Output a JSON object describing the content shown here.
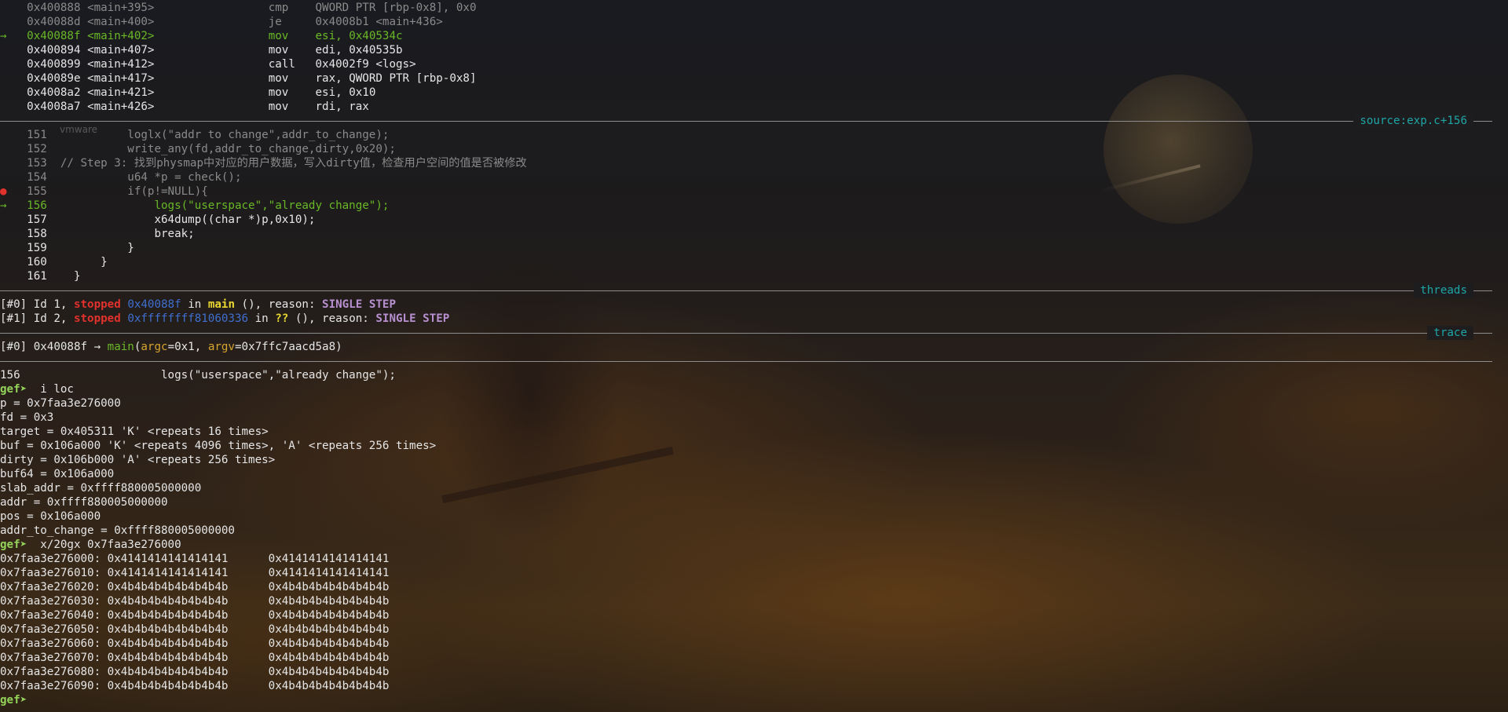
{
  "disasm": [
    {
      "addr": "0x400888",
      "sym": "<main+395>",
      "op": "cmp",
      "args": "QWORD PTR [rbp-0x8], 0x0"
    },
    {
      "addr": "0x40088d",
      "sym": "<main+400>",
      "op": "je",
      "args": "0x4008b1 <main+436>"
    },
    {
      "addr": "0x40088f",
      "sym": "<main+402>",
      "op": "mov",
      "args": "esi, 0x40534c",
      "current": true,
      "marker": "→"
    },
    {
      "addr": "0x400894",
      "sym": "<main+407>",
      "op": "mov",
      "args": "edi, 0x40535b"
    },
    {
      "addr": "0x400899",
      "sym": "<main+412>",
      "op": "call",
      "args": "0x4002f9 <logs>"
    },
    {
      "addr": "0x40089e",
      "sym": "<main+417>",
      "op": "mov",
      "args": "rax, QWORD PTR [rbp-0x8]"
    },
    {
      "addr": "0x4008a2",
      "sym": "<main+421>",
      "op": "mov",
      "args": "esi, 0x10"
    },
    {
      "addr": "0x4008a7",
      "sym": "<main+426>",
      "op": "mov",
      "args": "rdi, rax"
    }
  ],
  "sections": {
    "source": "source:exp.c+156",
    "threads": "threads",
    "trace": "trace"
  },
  "watermark": "vmware",
  "source_lines": [
    {
      "num": "151",
      "text": "        loglx(\"addr to change\",addr_to_change);",
      "style": "dim"
    },
    {
      "num": "152",
      "text": "        write_any(fd,addr_to_change,dirty,0x20);",
      "style": "dim"
    },
    {
      "num": "153",
      "text": "// Step 3: 找到physmap中对应的用户数据，写入dirty值，检查用户空间的值是否被修改",
      "style": "dim",
      "indent": "  "
    },
    {
      "num": "154",
      "text": "        u64 *p = check();",
      "style": "dim"
    },
    {
      "num": "155",
      "text": "        if(p!=NULL){",
      "style": "dim",
      "breakpoint": "●"
    },
    {
      "num": "156",
      "text": "            logs(\"userspace\",\"already change\");",
      "style": "current",
      "marker": "→"
    },
    {
      "num": "157",
      "text": "            x64dump((char *)p,0x10);",
      "style": "normal"
    },
    {
      "num": "158",
      "text": "            break;",
      "style": "normal"
    },
    {
      "num": "159",
      "text": "        }",
      "style": "normal"
    },
    {
      "num": "160",
      "text": "    }",
      "style": "normal"
    },
    {
      "num": "161",
      "text": "}",
      "style": "normal"
    }
  ],
  "threads": [
    {
      "idx": "[#0]",
      "id": " Id 1, ",
      "state": "stopped",
      "pc": "0x40088f",
      "in": " in ",
      "func": "main",
      "rest": " (), reason: ",
      "reason": "SINGLE STEP"
    },
    {
      "idx": "[#1]",
      "id": " Id 2, ",
      "state": "stopped",
      "pc": "0xffffffff81060336",
      "in": " in ",
      "func": "??",
      "rest": " (), reason: ",
      "reason": "SINGLE STEP"
    }
  ],
  "trace": {
    "idx": "[#0]",
    "pc": " 0x40088f → ",
    "func": "main",
    "open": "(",
    "arg1_name": "argc",
    "arg1_val": "=0x1, ",
    "arg2_name": "argv",
    "arg2_val": "=0x7ffc7aacd5a8)"
  },
  "console": {
    "current_line": "156                     logs(\"userspace\",\"already change\");",
    "prompt": "gef➤ ",
    "cmd1": " i loc",
    "locals": [
      "p = 0x7faa3e276000",
      "fd = 0x3",
      "target = 0x405311 'K' <repeats 16 times>",
      "buf = 0x106a000 'K' <repeats 4096 times>, 'A' <repeats 256 times>",
      "dirty = 0x106b000 'A' <repeats 256 times>",
      "buf64 = 0x106a000",
      "slab_addr = 0xffff880005000000",
      "addr = 0xffff880005000000",
      "pos = 0x106a000",
      "addr_to_change = 0xffff880005000000"
    ],
    "cmd2": " x/20gx 0x7faa3e276000",
    "memdump": [
      {
        "addr": "0x7faa3e276000:",
        "v1": "0x4141414141414141",
        "v2": "0x4141414141414141"
      },
      {
        "addr": "0x7faa3e276010:",
        "v1": "0x4141414141414141",
        "v2": "0x4141414141414141"
      },
      {
        "addr": "0x7faa3e276020:",
        "v1": "0x4b4b4b4b4b4b4b4b",
        "v2": "0x4b4b4b4b4b4b4b4b"
      },
      {
        "addr": "0x7faa3e276030:",
        "v1": "0x4b4b4b4b4b4b4b4b",
        "v2": "0x4b4b4b4b4b4b4b4b"
      },
      {
        "addr": "0x7faa3e276040:",
        "v1": "0x4b4b4b4b4b4b4b4b",
        "v2": "0x4b4b4b4b4b4b4b4b"
      },
      {
        "addr": "0x7faa3e276050:",
        "v1": "0x4b4b4b4b4b4b4b4b",
        "v2": "0x4b4b4b4b4b4b4b4b"
      },
      {
        "addr": "0x7faa3e276060:",
        "v1": "0x4b4b4b4b4b4b4b4b",
        "v2": "0x4b4b4b4b4b4b4b4b"
      },
      {
        "addr": "0x7faa3e276070:",
        "v1": "0x4b4b4b4b4b4b4b4b",
        "v2": "0x4b4b4b4b4b4b4b4b"
      },
      {
        "addr": "0x7faa3e276080:",
        "v1": "0x4b4b4b4b4b4b4b4b",
        "v2": "0x4b4b4b4b4b4b4b4b"
      },
      {
        "addr": "0x7faa3e276090:",
        "v1": "0x4b4b4b4b4b4b4b4b",
        "v2": "0x4b4b4b4b4b4b4b4b"
      }
    ],
    "final_prompt": "gef➤"
  },
  "colors": {
    "prompt": "#94d35a",
    "current": "#6ab827",
    "stopped": "#e0312c",
    "section_label": "#1ea6a6",
    "address": "#3f6fcf",
    "function": "#e8d630",
    "reason": "#b890d0"
  }
}
